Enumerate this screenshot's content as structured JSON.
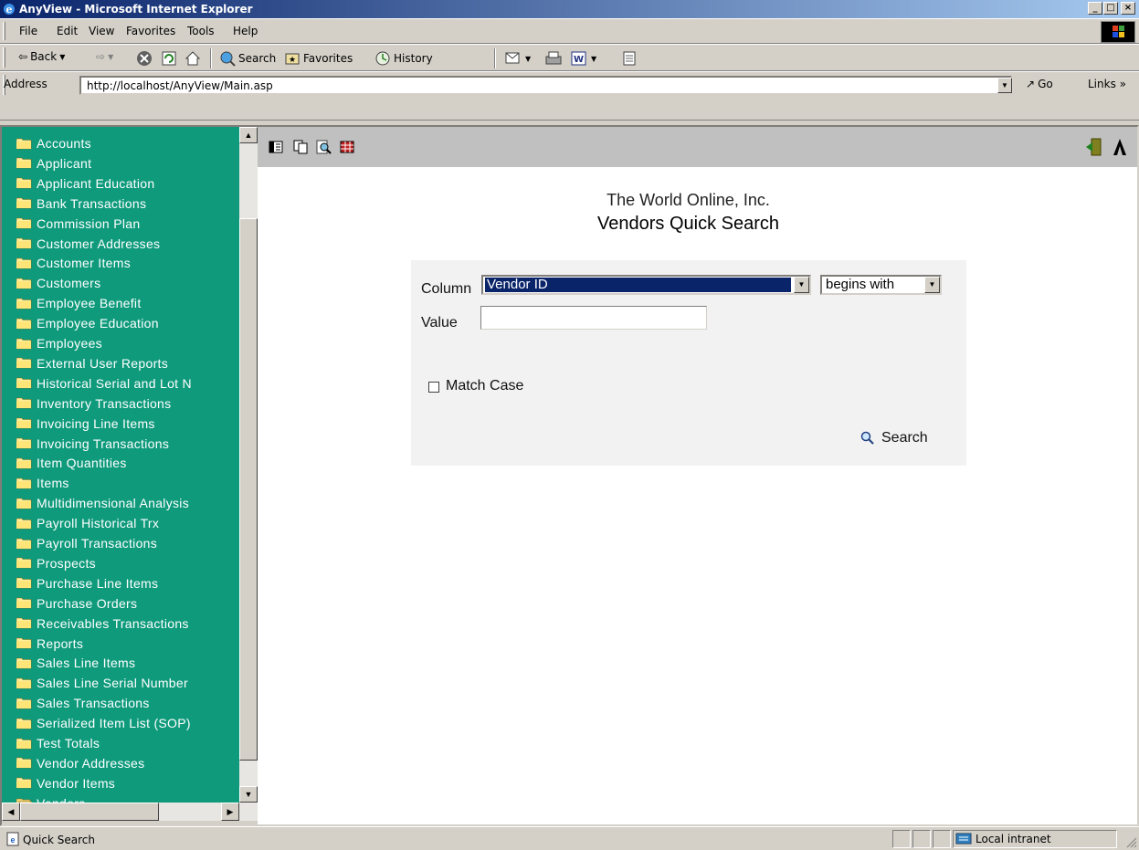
{
  "window": {
    "title": "AnyView - Microsoft Internet Explorer"
  },
  "menu": [
    "File",
    "Edit",
    "View",
    "Favorites",
    "Tools",
    "Help"
  ],
  "toolbar": {
    "back": "Back",
    "search": "Search",
    "favorites": "Favorites",
    "history": "History"
  },
  "address": {
    "label": "Address",
    "url": "http://localhost/AnyView/Main.asp",
    "go": "Go",
    "links": "Links »"
  },
  "sidebar": {
    "items": [
      "Accounts",
      "Applicant",
      "Applicant Education",
      "Bank Transactions",
      "Commission Plan",
      "Customer Addresses",
      "Customer Items",
      "Customers",
      "Employee Benefit",
      "Employee Education",
      "Employees",
      "External User Reports",
      "Historical Serial and Lot N",
      "Inventory Transactions",
      "Invoicing Line Items",
      "Invoicing Transactions",
      "Item Quantities",
      "Items",
      "Multidimensional Analysis",
      "Payroll Historical Trx",
      "Payroll Transactions",
      "Prospects",
      "Purchase Line Items",
      "Purchase Orders",
      "Receivables Transactions",
      "Reports",
      "Sales Line Items",
      "Sales Line Serial Number",
      "Sales Transactions",
      "Serialized Item List (SOP)",
      "Test Totals",
      "Vendor Addresses",
      "Vendor Items",
      "Vendors"
    ],
    "open_item": "Vendors"
  },
  "page": {
    "company": "The World Online, Inc.",
    "title": "Vendors Quick Search",
    "column_label": "Column",
    "column_value": "Vendor ID",
    "operator_value": "begins with",
    "value_label": "Value",
    "value_input": "",
    "match_case_label": "Match Case",
    "match_case_checked": false,
    "search_label": "Search"
  },
  "status": {
    "text": "Quick Search",
    "zone": "Local intranet"
  }
}
